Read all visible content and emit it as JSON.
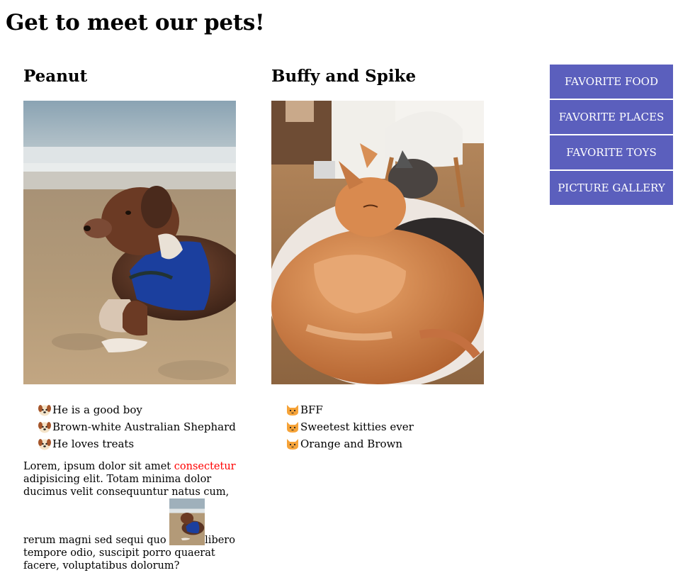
{
  "page": {
    "title": "Get to meet our pets!"
  },
  "pets": [
    {
      "name": "Peanut",
      "photo_icon": "dog-photo",
      "emoji_icon": "dog-face-icon",
      "traits": [
        "He is a good boy",
        "Brown-white Australian Shephard",
        "He loves treats"
      ]
    },
    {
      "name": "Buffy and Spike",
      "photo_icon": "cats-photo",
      "emoji_icon": "cat-face-icon",
      "traits": [
        "BFF",
        "Sweetest kitties ever",
        "Orange and Brown"
      ]
    }
  ],
  "article": {
    "part1": "Lorem, ipsum dolor sit amet ",
    "accent": "consectetur",
    "part2": " adipisicing elit. Totam minima dolor ducimus velit consequuntur natus cum, rerum magni sed sequi quo ",
    "part3": "libero tempore odio, suscipit porro quaerat facere, voluptatibus dolorum?",
    "accent_color": "#ff0000"
  },
  "menu": {
    "items": [
      "Favorite Food",
      "Favorite Places",
      "Favorite Toys",
      "Picture Gallery"
    ],
    "color": "#5b5fbd"
  }
}
